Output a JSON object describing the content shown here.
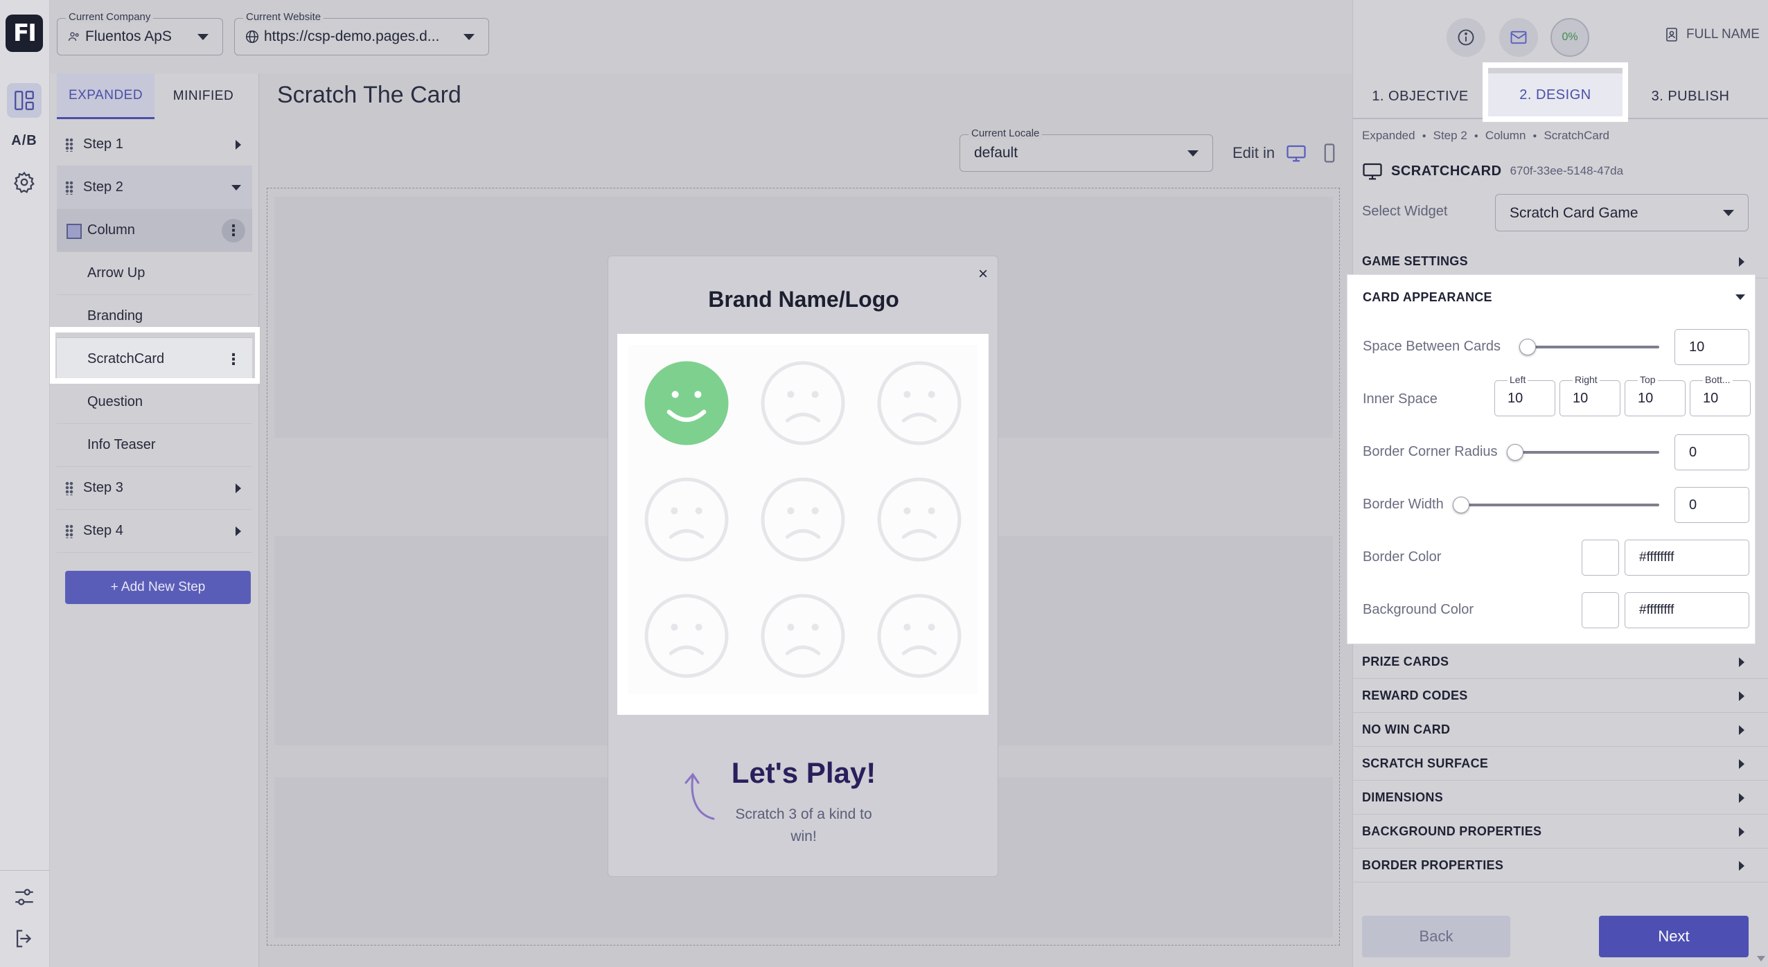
{
  "rail": {
    "logo_text": "FI",
    "ab_label": "A/B",
    "icons": [
      "layout-icon",
      "ab-test-icon",
      "settings-gear-icon",
      "sliders-icon",
      "logout-icon"
    ]
  },
  "topbar": {
    "company": {
      "label": "Current Company",
      "value": "Fluentos ApS"
    },
    "website": {
      "label": "Current Website",
      "value": "https://csp-demo.pages.d..."
    }
  },
  "left_panel": {
    "tabs": [
      {
        "label": "EXPANDED",
        "active": true
      },
      {
        "label": "MINIFIED",
        "active": false
      }
    ],
    "items": [
      {
        "label": "Step 1",
        "kind": "step"
      },
      {
        "label": "Step 2",
        "kind": "step",
        "expanded": true
      },
      {
        "label": "Column",
        "kind": "column"
      },
      {
        "label": "Arrow Up",
        "kind": "sub"
      },
      {
        "label": "Branding",
        "kind": "sub"
      },
      {
        "label": "ScratchCard",
        "kind": "sub",
        "selected": true
      },
      {
        "label": "Question",
        "kind": "sub"
      },
      {
        "label": "Info Teaser",
        "kind": "sub"
      },
      {
        "label": "Step 3",
        "kind": "step"
      },
      {
        "label": "Step 4",
        "kind": "step"
      }
    ],
    "add_step_label": "+ Add New Step"
  },
  "canvas": {
    "title": "Scratch The Card",
    "locale": {
      "label": "Current Locale",
      "value": "default"
    },
    "edit_in_label": "Edit in",
    "modal": {
      "close_glyph": "×",
      "brand": "Brand Name/Logo",
      "cards": [
        "happy",
        "sad",
        "sad",
        "sad",
        "sad",
        "sad",
        "sad",
        "sad",
        "sad"
      ],
      "play_title": "Let's Play!",
      "play_sub": "Scratch 3 of a kind to win!"
    }
  },
  "right_panel": {
    "progress_label": "0%",
    "full_name": "FULL NAME",
    "tabs": [
      {
        "label": "1. OBJECTIVE",
        "active": false
      },
      {
        "label": "2. DESIGN",
        "active": true
      },
      {
        "label": "3. PUBLISH",
        "active": false
      }
    ],
    "breadcrumb": [
      "Expanded",
      "Step 2",
      "Column",
      "ScratchCard"
    ],
    "widget_name": "SCRATCHCARD",
    "widget_id": "670f-33ee-5148-47da",
    "select_widget_label": "Select Widget",
    "select_widget_value": "Scratch Card Game",
    "sections_before": [
      "GAME SETTINGS"
    ],
    "card_appearance": {
      "title": "CARD APPEARANCE",
      "space_between": {
        "label": "Space Between Cards",
        "value": "10",
        "fraction": 0.05
      },
      "inner_space": {
        "label": "Inner Space",
        "fields": [
          {
            "label": "Left",
            "value": "10"
          },
          {
            "label": "Right",
            "value": "10"
          },
          {
            "label": "Top",
            "value": "10"
          },
          {
            "label": "Bott...",
            "value": "10"
          }
        ]
      },
      "corner_radius": {
        "label": "Border Corner Radius",
        "value": "0",
        "fraction": 0
      },
      "border_width": {
        "label": "Border Width",
        "value": "0",
        "fraction": 0
      },
      "border_color": {
        "label": "Border Color",
        "value": "#ffffffff"
      },
      "background_color": {
        "label": "Background Color",
        "value": "#ffffffff"
      }
    },
    "sections_after": [
      "PRIZE CARDS",
      "REWARD CODES",
      "NO WIN CARD",
      "SCRATCH SURFACE",
      "DIMENSIONS",
      "BACKGROUND PROPERTIES",
      "BORDER PROPERTIES"
    ],
    "back_label": "Back",
    "next_label": "Next"
  },
  "colors": {
    "accent": "#4e4fb2",
    "happy_face": "#7ed08f",
    "sad_face_stroke": "#e6e6ea"
  }
}
